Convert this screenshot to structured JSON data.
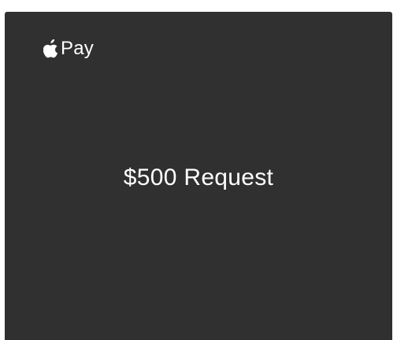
{
  "brand": {
    "icon": "apple-logo-icon",
    "label": "Pay"
  },
  "card": {
    "request_text": "$500 Request",
    "background_color": "#303031",
    "text_color": "#ffffff"
  }
}
